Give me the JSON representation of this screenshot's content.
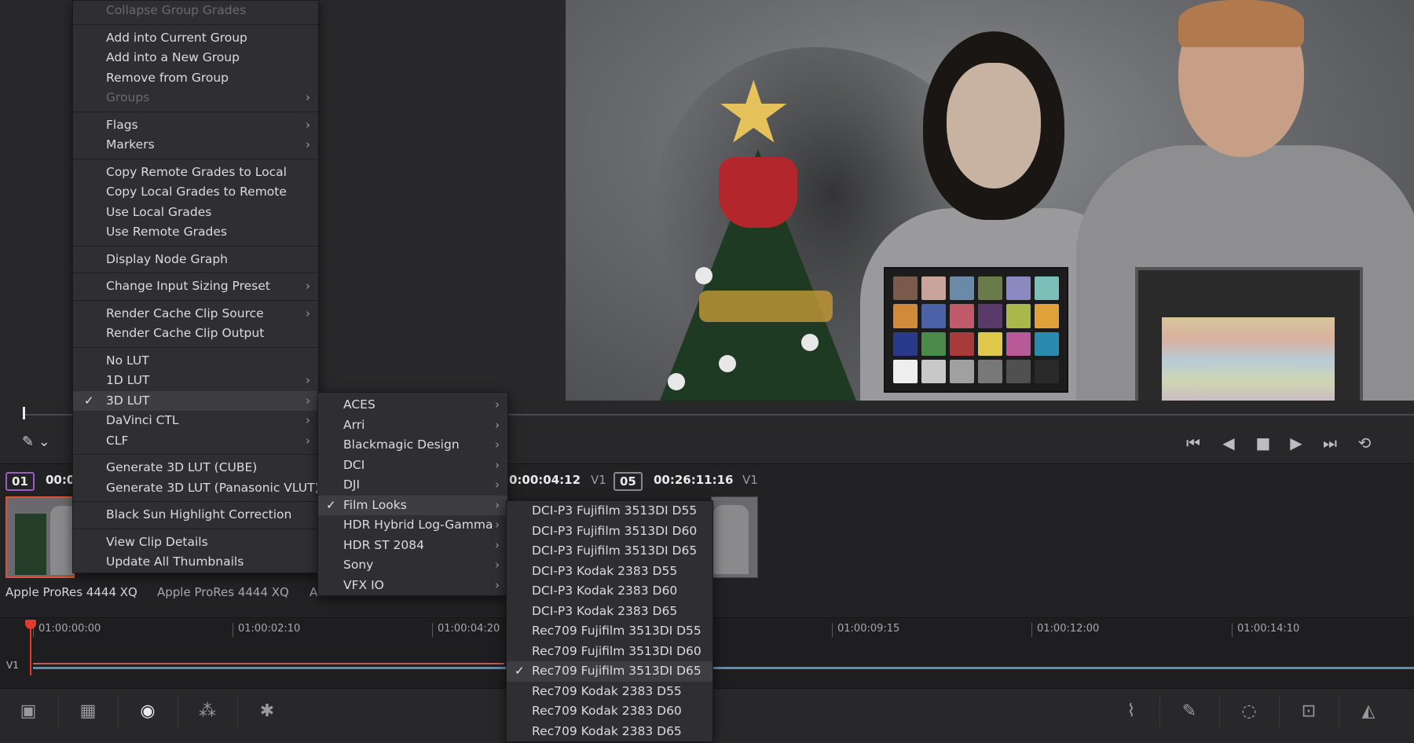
{
  "main_menu": {
    "items": [
      {
        "label": "Collapse Group Grades",
        "disabled": true
      },
      {
        "sep": true
      },
      {
        "label": "Add into Current Group"
      },
      {
        "label": "Add into a New Group"
      },
      {
        "label": "Remove from Group"
      },
      {
        "label": "Groups",
        "disabled": true,
        "submenu": true
      },
      {
        "sep": true
      },
      {
        "label": "Flags",
        "submenu": true
      },
      {
        "label": "Markers",
        "submenu": true
      },
      {
        "sep": true
      },
      {
        "label": "Copy Remote Grades to Local"
      },
      {
        "label": "Copy Local Grades to Remote"
      },
      {
        "label": "Use Local Grades"
      },
      {
        "label": "Use Remote Grades"
      },
      {
        "sep": true
      },
      {
        "label": "Display Node Graph"
      },
      {
        "sep": true
      },
      {
        "label": "Change Input Sizing Preset",
        "submenu": true
      },
      {
        "sep": true
      },
      {
        "label": "Render Cache Clip Source",
        "submenu": true
      },
      {
        "label": "Render Cache Clip Output"
      },
      {
        "sep": true
      },
      {
        "label": "No LUT"
      },
      {
        "label": "1D LUT",
        "submenu": true
      },
      {
        "label": "3D LUT",
        "submenu": true,
        "checked": true,
        "highlighted": true
      },
      {
        "label": "DaVinci CTL",
        "submenu": true
      },
      {
        "label": "CLF",
        "submenu": true
      },
      {
        "sep": true
      },
      {
        "label": "Generate 3D LUT (CUBE)"
      },
      {
        "label": "Generate 3D LUT (Panasonic VLUT)"
      },
      {
        "sep": true
      },
      {
        "label": "Black Sun Highlight Correction"
      },
      {
        "sep": true
      },
      {
        "label": "View Clip Details"
      },
      {
        "label": "Update All Thumbnails"
      }
    ]
  },
  "lut_menu": {
    "items": [
      {
        "label": "ACES",
        "submenu": true
      },
      {
        "label": "Arri",
        "submenu": true
      },
      {
        "label": "Blackmagic Design",
        "submenu": true
      },
      {
        "label": "DCI",
        "submenu": true
      },
      {
        "label": "DJI",
        "submenu": true
      },
      {
        "label": "Film Looks",
        "submenu": true,
        "checked": true,
        "highlighted": true
      },
      {
        "label": "HDR Hybrid Log-Gamma",
        "submenu": true
      },
      {
        "label": "HDR ST 2084",
        "submenu": true
      },
      {
        "label": "Sony",
        "submenu": true
      },
      {
        "label": "VFX IO",
        "submenu": true
      }
    ]
  },
  "film_menu": {
    "items": [
      {
        "label": "DCI-P3 Fujifilm 3513DI D55"
      },
      {
        "label": "DCI-P3 Fujifilm 3513DI D60"
      },
      {
        "label": "DCI-P3 Fujifilm 3513DI D65"
      },
      {
        "label": "DCI-P3 Kodak 2383 D55"
      },
      {
        "label": "DCI-P3 Kodak 2383 D60"
      },
      {
        "label": "DCI-P3 Kodak 2383 D65"
      },
      {
        "label": "Rec709 Fujifilm 3513DI D55"
      },
      {
        "label": "Rec709 Fujifilm 3513DI D60"
      },
      {
        "label": "Rec709 Fujifilm 3513DI D65",
        "checked": true,
        "highlighted": true
      },
      {
        "label": "Rec709 Kodak 2383 D55"
      },
      {
        "label": "Rec709 Kodak 2383 D60"
      },
      {
        "label": "Rec709 Kodak 2383 D65"
      }
    ]
  },
  "clips": {
    "clip1_number": "01",
    "clip1_tc_partial": "00:0",
    "clip4_tc": "0:00:04:12",
    "clip4_track": "V1",
    "clip5_number": "05",
    "clip5_tc": "00:26:11:16",
    "clip5_track": "V1",
    "clip1_label": "Apple ProRes 4444 XQ",
    "clip2_label": "Apple ProRes 4444 XQ",
    "clip3_label_partial": "A"
  },
  "timeline": {
    "timecodes": [
      "01:00:00:00",
      "01:00:02:10",
      "01:00:04:20",
      "01:00:09:15",
      "01:00:12:00",
      "01:00:14:10"
    ],
    "track_label": "V1"
  },
  "colors": {
    "accent_selected_clip": "#e0522f",
    "playhead": "#e23b2a",
    "clip1_tag_border": "#a05ac8",
    "track_blue": "#5a8fb8"
  },
  "icons": {
    "transport": [
      "skip-to-start-icon",
      "play-reverse-icon",
      "stop-icon",
      "play-icon",
      "skip-to-end-icon",
      "loop-icon"
    ],
    "bottom_left": [
      "camera-raw-icon",
      "color-match-icon",
      "color-wheels-icon",
      "rgb-mixer-icon",
      "motion-effects-icon"
    ],
    "bottom_right": [
      "curves-icon",
      "qualifier-icon",
      "window-icon",
      "tracker-icon",
      "blur-icon"
    ]
  }
}
